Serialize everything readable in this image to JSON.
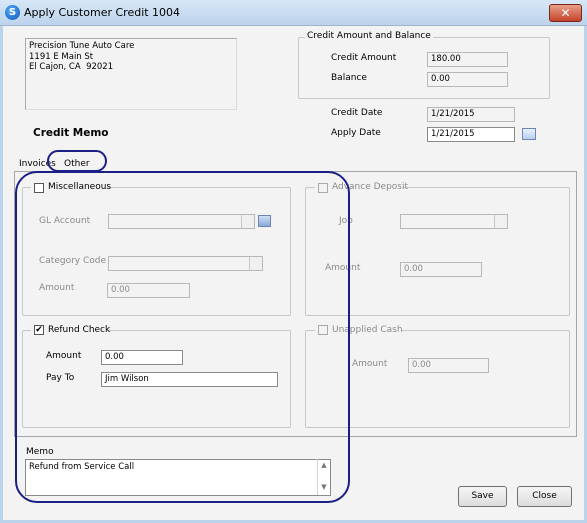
{
  "window": {
    "title": "Apply Customer Credit 1004",
    "close_glyph": "✕"
  },
  "customer": {
    "address": "Precision Tune Auto Care\n1191 E Main St\nEl Cajon, CA  92021"
  },
  "credit": {
    "group_label": "Credit Amount and Balance",
    "amount_label": "Credit Amount",
    "amount_value": "180.00",
    "balance_label": "Balance",
    "balance_value": "0.00",
    "date_label": "Credit Date",
    "date_value": "1/21/2015",
    "apply_date_label": "Apply Date",
    "apply_date_value": "1/21/2015"
  },
  "heading": "Credit Memo",
  "tabs": [
    {
      "label": "Invoices",
      "active": false
    },
    {
      "label": "Other",
      "active": true
    }
  ],
  "misc": {
    "label": "Miscellaneous",
    "checked": false,
    "gl_account_label": "GL Account",
    "gl_account_value": "",
    "category_label": "Category Code",
    "category_value": "",
    "amount_label": "Amount",
    "amount_value": "0.00"
  },
  "advance": {
    "label": "Advance Deposit",
    "checked": false,
    "job_label": "Job",
    "job_value": "",
    "amount_label": "Amount",
    "amount_value": "0.00"
  },
  "refund": {
    "label": "Refund Check",
    "checked": true,
    "check_glyph": "✔",
    "amount_label": "Amount",
    "amount_value": "0.00",
    "payto_label": "Pay To",
    "payto_value": "Jim Wilson"
  },
  "unapplied": {
    "label": "Unapplied Cash",
    "checked": false,
    "amount_label": "Amount",
    "amount_value": "0.00"
  },
  "memo": {
    "label": "Memo",
    "value": "Refund from Service Call"
  },
  "buttons": {
    "save": "Save",
    "close": "Close"
  },
  "colors": {
    "annotation_oval": "#1b1f86",
    "titlebar": "#bcd3ec",
    "close_button": "#c4442a"
  },
  "icons": [
    "app-icon",
    "close-icon",
    "calendar-icon",
    "lookup-icon",
    "checkmark-icon",
    "scroll-up-icon",
    "scroll-down-icon"
  ]
}
